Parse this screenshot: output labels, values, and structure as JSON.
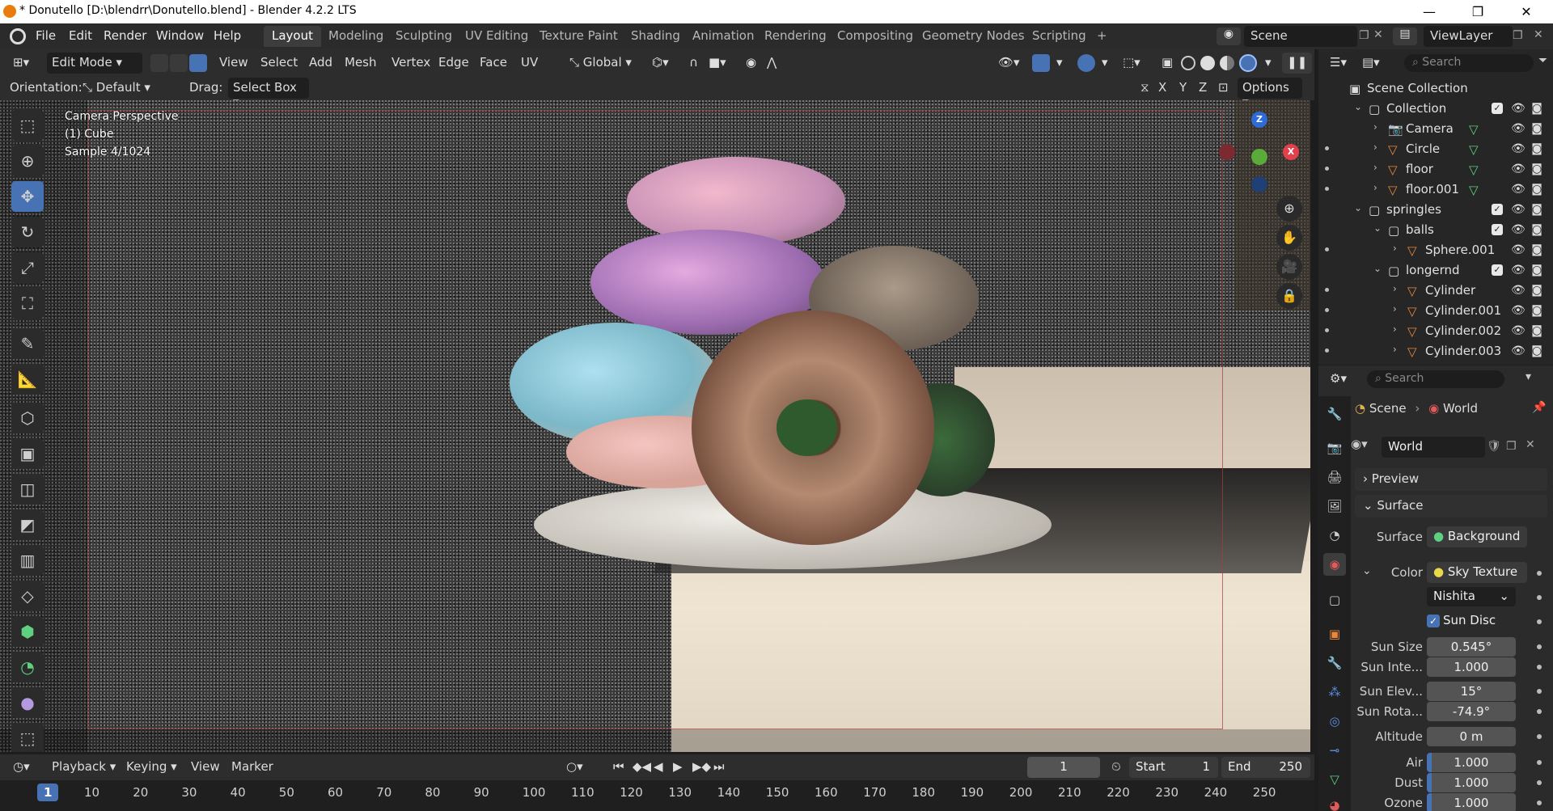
{
  "window": {
    "title": "* Donutello [D:\\blendrr\\Donutello.blend] - Blender 4.2.2 LTS",
    "minimize": "—",
    "maximize": "❐",
    "close": "✕"
  },
  "menu": [
    "File",
    "Edit",
    "Render",
    "Window",
    "Help"
  ],
  "workspaces": [
    "Layout",
    "Modeling",
    "Sculpting",
    "UV Editing",
    "Texture Paint",
    "Shading",
    "Animation",
    "Rendering",
    "Compositing",
    "Geometry Nodes",
    "Scripting"
  ],
  "active_workspace": "Layout",
  "add_workspace": "+",
  "scene_name": "Scene",
  "view_layer": "ViewLayer",
  "viewport_header": {
    "mode": "Edit Mode",
    "menus": [
      "View",
      "Select",
      "Add",
      "Mesh",
      "Vertex",
      "Edge",
      "Face",
      "UV"
    ],
    "transform_orientation": "Global",
    "orientation_label": "Orientation:",
    "orientation_value": "Default",
    "drag_label": "Drag:",
    "drag_value": "Select Box",
    "axes": [
      "X",
      "Y",
      "Z"
    ],
    "options": "Options"
  },
  "viewport_overlay": {
    "view_name": "Camera Perspective",
    "object": "(1) Cube",
    "sample": "Sample 4/1024"
  },
  "gizmo": {
    "x": "X",
    "y": "Y",
    "z": "Z"
  },
  "timeline": {
    "menus": [
      "Playback",
      "Keying",
      "View",
      "Marker"
    ],
    "current_frame": "1",
    "start_label": "Start",
    "start": "1",
    "end_label": "End",
    "end": "250",
    "ruler": [
      "1",
      "10",
      "20",
      "30",
      "40",
      "50",
      "60",
      "70",
      "80",
      "90",
      "100",
      "110",
      "120",
      "130",
      "140",
      "150",
      "160",
      "170",
      "180",
      "190",
      "200",
      "210",
      "220",
      "230",
      "240",
      "250"
    ]
  },
  "outliner": {
    "search_placeholder": "Search",
    "items": [
      {
        "label": "Scene Collection",
        "depth": 0,
        "type": "scene"
      },
      {
        "label": "Collection",
        "depth": 1,
        "type": "collection"
      },
      {
        "label": "Camera",
        "depth": 2,
        "type": "camera"
      },
      {
        "label": "Circle",
        "depth": 2,
        "type": "mesh"
      },
      {
        "label": "floor",
        "depth": 2,
        "type": "mesh"
      },
      {
        "label": "floor.001",
        "depth": 2,
        "type": "mesh"
      },
      {
        "label": "springles",
        "depth": 1,
        "type": "collection"
      },
      {
        "label": "balls",
        "depth": 2,
        "type": "collection"
      },
      {
        "label": "Sphere.001",
        "depth": 3,
        "type": "mesh"
      },
      {
        "label": "longernd",
        "depth": 2,
        "type": "collection"
      },
      {
        "label": "Cylinder",
        "depth": 3,
        "type": "mesh"
      },
      {
        "label": "Cylinder.001",
        "depth": 3,
        "type": "mesh"
      },
      {
        "label": "Cylinder.002",
        "depth": 3,
        "type": "mesh"
      },
      {
        "label": "Cylinder.003",
        "depth": 3,
        "type": "mesh"
      }
    ]
  },
  "properties": {
    "search_placeholder": "Search",
    "breadcrumb_scene": "Scene",
    "breadcrumb_sep": "›",
    "breadcrumb_world": "World",
    "world_name": "World",
    "panels": {
      "preview": "Preview",
      "surface": "Surface"
    },
    "surface_label": "Surface",
    "surface_value": "Background",
    "color_label": "Color",
    "color_value": "Sky Texture",
    "sky_type": "Nishita",
    "sun_disc": "Sun Disc",
    "fields": [
      {
        "label": "Sun Size",
        "value": "0.545°"
      },
      {
        "label": "Sun Inte...",
        "value": "1.000"
      },
      {
        "label": "Sun Elev...",
        "value": "15°"
      },
      {
        "label": "Sun Rota...",
        "value": "-74.9°"
      },
      {
        "label": "Altitude",
        "value": "0 m"
      },
      {
        "label": "Air",
        "value": "1.000"
      },
      {
        "label": "Dust",
        "value": "1.000"
      },
      {
        "label": "Ozone",
        "value": "1.000"
      }
    ]
  },
  "colors": {
    "accent": "#4772b3",
    "orange_object": "#e8883a",
    "green_modifier": "#5fcf80",
    "titlebar": "#ffffff"
  }
}
